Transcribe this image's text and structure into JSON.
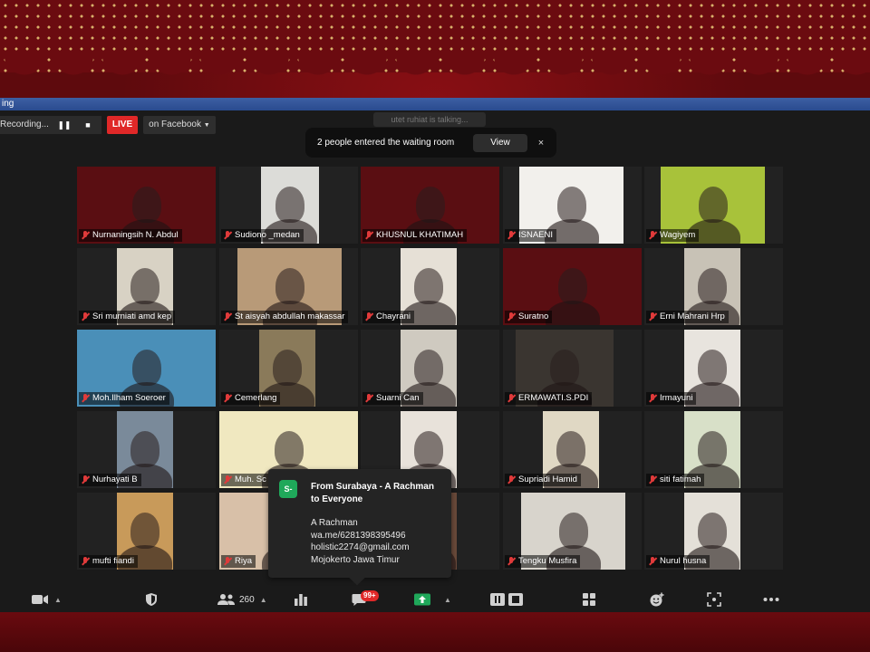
{
  "titlebar": {
    "text": "ing"
  },
  "recording": {
    "label": "Recording...",
    "pause_icon": "pause-icon",
    "stop_icon": "stop-icon"
  },
  "live": {
    "badge": "LIVE",
    "destination": "on Facebook"
  },
  "talking": {
    "text": "utet ruhiat is talking..."
  },
  "waiting_room": {
    "message": "2 people entered the waiting room",
    "view_label": "View",
    "close_label": "×"
  },
  "participants": [
    {
      "name": "Nurnaningsih N. Abdul",
      "bg": "#5a0e12",
      "muted": true
    },
    {
      "name": "Sudiono _medan",
      "bg": "#dcdcd8",
      "muted": true
    },
    {
      "name": "KHUSNUL KHATIMAH",
      "bg": "#5a0e12",
      "muted": true
    },
    {
      "name": "ISNAENI",
      "bg": "#f2f0ec",
      "muted": true
    },
    {
      "name": "Wagiyem",
      "bg": "#a8c23a",
      "muted": true
    },
    {
      "name": "Sri murniati amd kep",
      "bg": "#d8d2c4",
      "muted": true
    },
    {
      "name": "St aisyah abdullah makassar",
      "bg": "#b89a78",
      "muted": true
    },
    {
      "name": "Chayrani",
      "bg": "#e6e0d6",
      "muted": true
    },
    {
      "name": "Suratno",
      "bg": "#5a0e12",
      "muted": true
    },
    {
      "name": "Erni Mahrani Hrp",
      "bg": "#c8c2b6",
      "muted": true
    },
    {
      "name": "Moh.Ilham Soeroer",
      "bg": "#4a8fb8",
      "muted": true
    },
    {
      "name": "Cemerlang",
      "bg": "#8a7a5a",
      "muted": true
    },
    {
      "name": "Suarni Can",
      "bg": "#cfcac0",
      "muted": true
    },
    {
      "name": "ERMAWATI.S.PDI",
      "bg": "#3a3530",
      "muted": true
    },
    {
      "name": "Irmayuni",
      "bg": "#e8e4de",
      "muted": true
    },
    {
      "name": "Nurhayati B",
      "bg": "#7a8a9a",
      "muted": true
    },
    {
      "name": "Muh. Sc",
      "bg": "#f0e8c0",
      "muted": true
    },
    {
      "name": "",
      "bg": "#e8e2da",
      "muted": false
    },
    {
      "name": "Supriadi Hamid",
      "bg": "#e0d8c4",
      "muted": true
    },
    {
      "name": "siti fatimah",
      "bg": "#d8e0c8",
      "muted": true
    },
    {
      "name": "mufti fiandi",
      "bg": "#c89a5a",
      "muted": true
    },
    {
      "name": "Riya",
      "bg": "#d8c0a8",
      "muted": true
    },
    {
      "name": "",
      "bg": "#6a4a3a",
      "muted": false
    },
    {
      "name": "Tengku Musfira",
      "bg": "#d8d4cc",
      "muted": true
    },
    {
      "name": "Nurul husna",
      "bg": "#e4e0d8",
      "muted": true
    }
  ],
  "chat": {
    "avatar": "S-",
    "from": "From Surabaya - A Rachman to Everyone",
    "lines": [
      "A Rachman",
      "wa.me/6281398395496",
      "holistic2274@gmail.com",
      "Mojokerto Jawa Timur"
    ]
  },
  "toolbar": {
    "video_icon": "video-camera-icon",
    "security_icon": "shield-icon",
    "participants_icon": "participants-icon",
    "participants_count": "260",
    "polls_icon": "bar-chart-icon",
    "chat_icon": "chat-bubble-icon",
    "chat_badge": "99+",
    "share_icon": "share-screen-icon",
    "record_icon": "pause-stop-icon",
    "apps_icon": "grid-apps-icon",
    "reactions_icon": "smiley-add-icon",
    "zoom_apps_icon": "expand-icon",
    "more_icon": "more-dots-icon"
  },
  "colors": {
    "accent_green": "#1fa85a",
    "live_red": "#e02828",
    "banner_red": "#6b0b10",
    "gold": "#d8b06a"
  }
}
